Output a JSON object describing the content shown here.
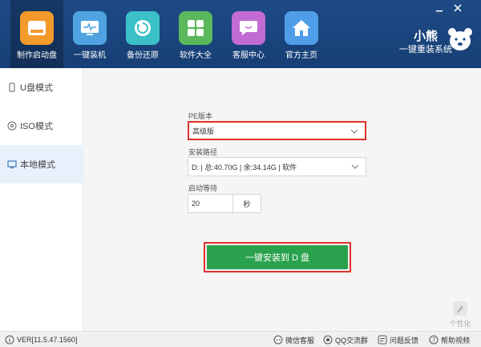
{
  "header": {
    "nav": [
      {
        "label": "制作启动盘",
        "icon": "usb-drive-icon"
      },
      {
        "label": "一键装机",
        "icon": "monitor-pulse-icon"
      },
      {
        "label": "备份还原",
        "icon": "restore-icon"
      },
      {
        "label": "软件大全",
        "icon": "apps-grid-icon"
      },
      {
        "label": "客服中心",
        "icon": "chat-bubble-icon"
      },
      {
        "label": "官方主页",
        "icon": "home-icon"
      }
    ],
    "brand_name": "小熊",
    "brand_sub": "一键重装系统"
  },
  "sidebar": {
    "items": [
      {
        "label": "U盘模式"
      },
      {
        "label": "ISO模式"
      },
      {
        "label": "本地模式"
      }
    ]
  },
  "form": {
    "pe_label": "PE版本",
    "pe_value": "高级版",
    "path_label": "安装路径",
    "path_value": "D: | 总:40.70G | 余:34.14G | 软件",
    "wait_label": "启动等待",
    "wait_value": "20",
    "wait_unit": "秒"
  },
  "install_button": "一键安装到 D 盘",
  "skin_label": "个性化",
  "statusbar": {
    "version": "VER[11.5.47.1560]",
    "wechat": "微信客服",
    "qq": "QQ交流群",
    "feedback": "问题反馈",
    "help": "帮助视频"
  },
  "colors": {
    "header": "#1e4a86",
    "accent_green": "#2aa24d",
    "highlight_red": "#e0312b"
  }
}
